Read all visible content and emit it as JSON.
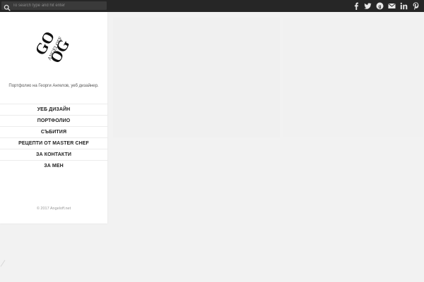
{
  "search": {
    "placeholder": "To search type and hit enter"
  },
  "social": {
    "icons": [
      "facebook-icon",
      "twitter-icon",
      "google-plus-icon",
      "email-icon",
      "linkedin-icon",
      "pinterest-icon"
    ]
  },
  "sidebar": {
    "tagline": "Портфолио на Георги Ангелов, уеб дизайнер.",
    "menu": [
      {
        "label": "УЕБ ДИЗАЙН"
      },
      {
        "label": "ПОРТФОЛИО"
      },
      {
        "label": "СЪБИТИЯ"
      },
      {
        "label": "РЕЦЕПТИ ОТ MASTER CHEF"
      },
      {
        "label": "ЗА КОНТАКТИ"
      },
      {
        "label": "ЗА МЕН"
      }
    ],
    "copyright": "© 2017 Angeloff.net"
  },
  "colors": {
    "topbar": "#262626",
    "page_background": "#f2f2f2",
    "sidebar_background": "#ffffff",
    "menu_text": "#222222"
  }
}
